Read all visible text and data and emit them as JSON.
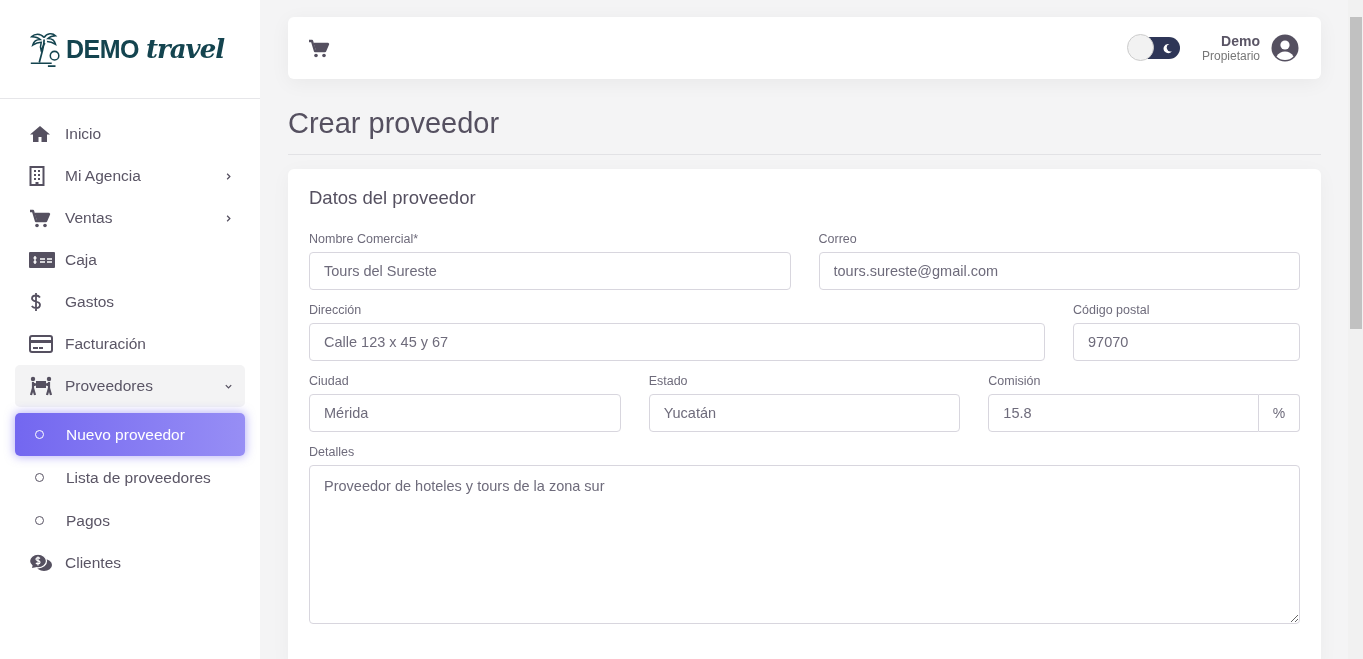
{
  "sidebar": {
    "logo": {
      "word": "DEMO",
      "script": "travel"
    },
    "items": [
      {
        "label": "Inicio",
        "kind": "link"
      },
      {
        "label": "Mi Agencia",
        "kind": "group",
        "expanded": false
      },
      {
        "label": "Ventas",
        "kind": "group",
        "expanded": false
      },
      {
        "label": "Caja",
        "kind": "link"
      },
      {
        "label": "Gastos",
        "kind": "link"
      },
      {
        "label": "Facturación",
        "kind": "link"
      },
      {
        "label": "Proveedores",
        "kind": "group",
        "expanded": true,
        "children": [
          {
            "label": "Nuevo proveedor",
            "selected": true
          },
          {
            "label": "Lista de proveedores",
            "selected": false
          },
          {
            "label": "Pagos",
            "selected": false
          }
        ]
      },
      {
        "label": "Clientes",
        "kind": "link"
      }
    ]
  },
  "topbar": {
    "dark_mode": false,
    "user": {
      "name": "Demo",
      "role": "Propietario"
    }
  },
  "page_title": "Crear proveedor",
  "card": {
    "title": "Datos del proveedor",
    "rows": [
      {
        "kind": "pair",
        "fields": [
          {
            "label": "Nombre Comercial*",
            "value": "Tours del Sureste",
            "kind": "text"
          },
          {
            "label": "Correo",
            "value": "tours.sureste@gmail.com",
            "kind": "text"
          }
        ]
      },
      {
        "kind": "main-side",
        "fields": [
          {
            "label": "Dirección",
            "value": "Calle 123 x 45 y 67",
            "kind": "text"
          },
          {
            "label": "Código postal",
            "value": "97070",
            "kind": "text"
          }
        ]
      },
      {
        "kind": "triple",
        "fields": [
          {
            "label": "Ciudad",
            "value": "Mérida",
            "kind": "text"
          },
          {
            "label": "Estado",
            "value": "Yucatán",
            "kind": "text"
          },
          {
            "label": "Comisión",
            "value": "15.8",
            "kind": "addon",
            "suffix": "%"
          }
        ]
      },
      {
        "kind": "full",
        "fields": [
          {
            "label": "Detalles",
            "value": "Proveedor de hoteles y tours de la zona sur",
            "kind": "textarea"
          }
        ]
      }
    ]
  }
}
